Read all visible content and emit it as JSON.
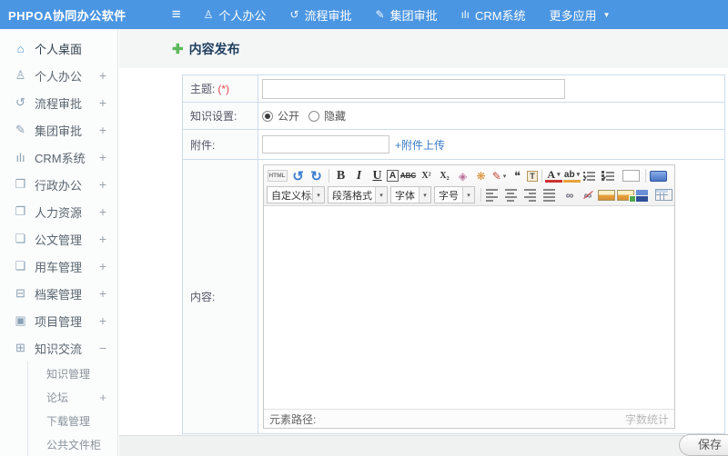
{
  "colors": {
    "topbar_bg": "#4b96e2",
    "accent": "#4b96e2",
    "title": "#1d3d5e",
    "link": "#3a7bc8",
    "required": "#e5484d",
    "table_border": "#ccdcec"
  },
  "topbar": {
    "brand": "PHPOA协同办公软件",
    "menu_icon": "≡",
    "items": [
      {
        "id": "personal-office",
        "label": "个人办公",
        "icon": "user-icon",
        "glyph": "♙"
      },
      {
        "id": "workflow-approval",
        "label": "流程审批",
        "icon": "process-icon",
        "glyph": "↺"
      },
      {
        "id": "group-approval",
        "label": "集团审批",
        "icon": "edit-icon",
        "glyph": "✎"
      },
      {
        "id": "crm-system",
        "label": "CRM系统",
        "icon": "chart-icon",
        "glyph": "ılı"
      },
      {
        "id": "more-apps",
        "label": "更多应用",
        "icon": "caret-down-icon",
        "glyph": "▼",
        "caret": true
      }
    ]
  },
  "sidebar": {
    "items": [
      {
        "id": "personal-desktop",
        "label": "个人桌面",
        "icon": "home-icon",
        "glyph": "⌂",
        "active": true,
        "expander": ""
      },
      {
        "id": "personal-office",
        "label": "个人办公",
        "icon": "user-icon",
        "glyph": "♙",
        "expander": "+"
      },
      {
        "id": "workflow-approval",
        "label": "流程审批",
        "icon": "process-icon",
        "glyph": "↺",
        "expander": "+"
      },
      {
        "id": "group-approval",
        "label": "集团审批",
        "icon": "edit-icon",
        "glyph": "✎",
        "expander": "+"
      },
      {
        "id": "crm-system",
        "label": "CRM系统",
        "icon": "chart-icon",
        "glyph": "ılı",
        "expander": "+"
      },
      {
        "id": "admin-office",
        "label": "行政办公",
        "icon": "briefcase-icon",
        "glyph": "❒",
        "expander": "+"
      },
      {
        "id": "human-resources",
        "label": "人力资源",
        "icon": "book-icon",
        "glyph": "❐",
        "expander": "+"
      },
      {
        "id": "document-management",
        "label": "公文管理",
        "icon": "document-icon",
        "glyph": "❏",
        "expander": "+"
      },
      {
        "id": "vehicle-management",
        "label": "用车管理",
        "icon": "car-icon",
        "glyph": "❑",
        "expander": "+"
      },
      {
        "id": "archive-management",
        "label": "档案管理",
        "icon": "archive-icon",
        "glyph": "⊟",
        "expander": "+"
      },
      {
        "id": "project-management",
        "label": "项目管理",
        "icon": "project-icon",
        "glyph": "▣",
        "expander": "+"
      },
      {
        "id": "knowledge-exchange",
        "label": "知识交流",
        "icon": "knowledge-icon",
        "glyph": "⊞",
        "expander": "−",
        "active_group": true
      }
    ],
    "subitems": [
      {
        "id": "knowledge-management",
        "label": "知识管理",
        "expander": ""
      },
      {
        "id": "forum",
        "label": "论坛",
        "expander": "+"
      },
      {
        "id": "download-management",
        "label": "下载管理",
        "expander": ""
      },
      {
        "id": "public-file-cabinet",
        "label": "公共文件柜",
        "expander": ""
      }
    ]
  },
  "main": {
    "page_title": "内容发布",
    "add_icon": "✚",
    "form": {
      "subject_label": "主题:",
      "required_mark": "(*)",
      "knowledge_label": "知识设置:",
      "radio_public": "公开",
      "radio_hidden": "隐藏",
      "attachment_label": "附件:",
      "upload_link": "+附件上传",
      "content_label": "内容:"
    },
    "editor": {
      "dropdown_arrow": "▾",
      "toolbar_row1": [
        {
          "name": "html-source-icon",
          "glyph": "HTML",
          "cls": "tb-html"
        },
        {
          "name": "undo-icon",
          "glyph": "↺",
          "cls": "tb-blue"
        },
        {
          "name": "redo-icon",
          "glyph": "↻",
          "cls": "tb-blue"
        },
        {
          "sep": true
        },
        {
          "name": "bold-icon",
          "glyph": "B",
          "cls": "tb-serif"
        },
        {
          "name": "italic-icon",
          "glyph": "I",
          "cls": "tb-serif tb-it"
        },
        {
          "name": "underline-icon",
          "glyph": "U",
          "cls": "tb-serif tb-un"
        },
        {
          "name": "bordered-text-icon",
          "glyph": "A",
          "cls": "tb-boxed"
        },
        {
          "name": "strikethrough-icon",
          "glyph": "ABC",
          "cls": "tb-abc"
        },
        {
          "name": "superscript-icon",
          "glyph": "X²",
          "cls": "tb-xs"
        },
        {
          "name": "subscript-icon",
          "glyph": "X₂",
          "cls": "tb-xs"
        },
        {
          "name": "eraser-icon",
          "glyph": "◈",
          "cls": "tb-eraser"
        },
        {
          "name": "clean-format-icon",
          "glyph": "❋",
          "cls": "tb-orange"
        },
        {
          "name": "format-painter-icon",
          "glyph": "✎",
          "cls": "tb-red",
          "arrow": true
        },
        {
          "name": "blockquote-icon",
          "glyph": "❝",
          "cls": "tb-quote"
        },
        {
          "name": "paste-text-icon",
          "glyph": "T",
          "cls": "tb-paste"
        },
        {
          "sep": true
        },
        {
          "name": "font-color-icon",
          "glyph": "A",
          "cls": "tb-fore",
          "arrow": true
        },
        {
          "name": "highlight-color-icon",
          "glyph": "ab",
          "cls": "tb-hilite",
          "arrow": true
        },
        {
          "name": "ordered-list-icon",
          "cls": "ic ic-ol",
          "arrow": true
        },
        {
          "name": "unordered-list-icon",
          "cls": "ic ic-ul",
          "arrow": true
        },
        {
          "name": "new-page-icon",
          "cls": "ic ic-page"
        },
        {
          "sep": true
        },
        {
          "name": "fullscreen-icon",
          "cls": "ic ic-monitor"
        }
      ],
      "toolbar_row2_selects": [
        {
          "name": "heading-select",
          "label": "自定义标题"
        },
        {
          "name": "paragraph-format-select",
          "label": "段落格式"
        },
        {
          "name": "font-family-select",
          "label": "字体"
        },
        {
          "name": "font-size-select",
          "label": "字号"
        }
      ],
      "toolbar_row2_icons": [
        {
          "sep": true
        },
        {
          "name": "align-left-icon",
          "cls": "ic ic-al"
        },
        {
          "name": "align-center-icon",
          "cls": "ic ic-ac"
        },
        {
          "name": "align-right-icon",
          "cls": "ic ic-ar"
        },
        {
          "name": "align-justify-icon",
          "cls": "ic ic-aj"
        },
        {
          "name": "link-icon",
          "glyph": "∞",
          "cls": "tb-link"
        },
        {
          "name": "unlink-icon",
          "glyph": "∞",
          "cls": "tb-link tb-unlink"
        },
        {
          "name": "image-icon",
          "cls": "ic ic-img"
        },
        {
          "name": "insert-image-icon",
          "cls": "ic ic-img ic-img-add"
        },
        {
          "name": "media-icon",
          "cls": "ic ic-media"
        },
        {
          "name": "table-icon",
          "cls": "ic ic-table"
        }
      ],
      "path_label": "元素路径:",
      "wordcount_label": "字数统计"
    },
    "save_label": "保存"
  }
}
